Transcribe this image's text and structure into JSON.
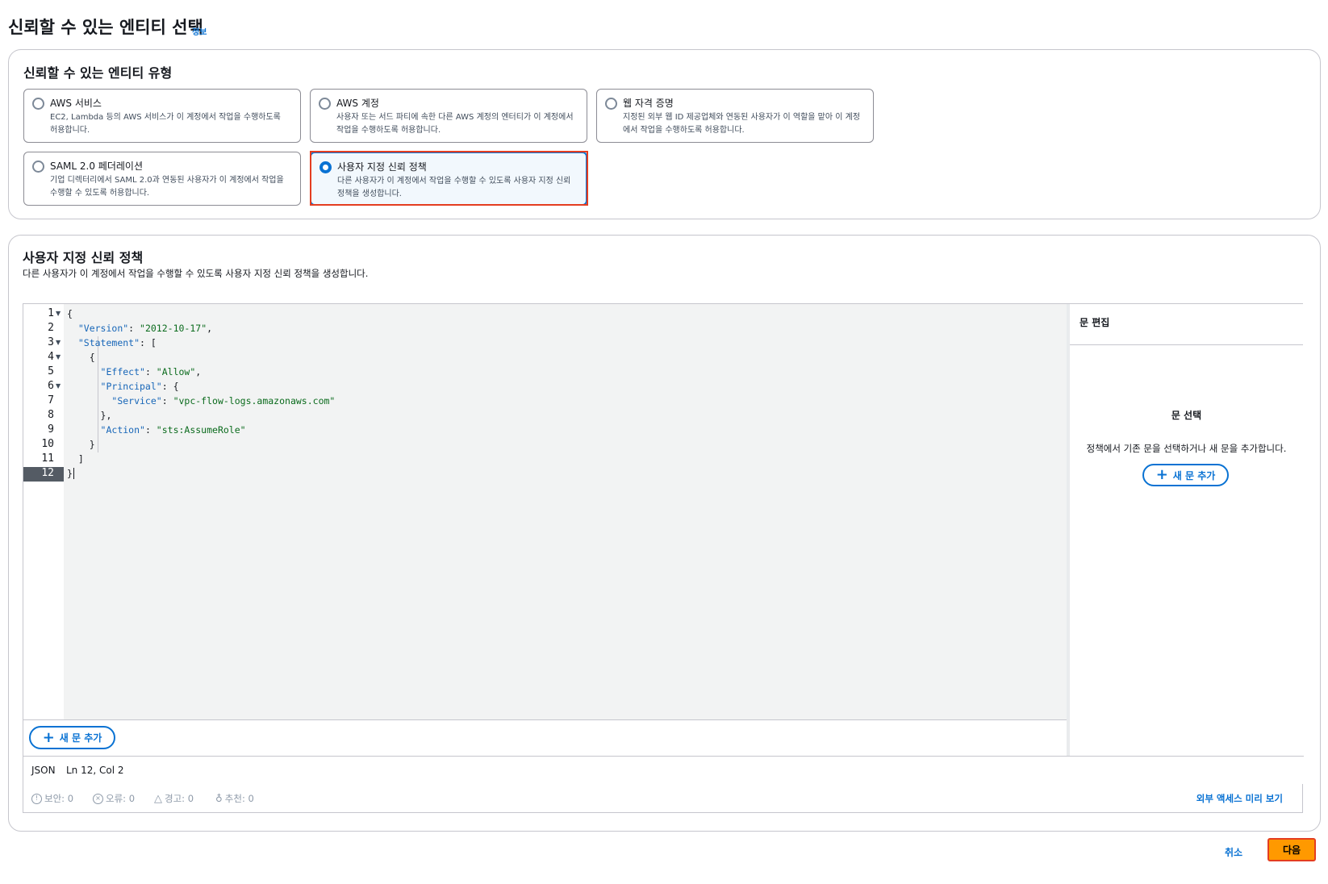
{
  "header": {
    "title": "신뢰할 수 있는 엔티티 선택",
    "info_link": "정보"
  },
  "entity_type_panel": {
    "title": "신뢰할 수 있는 엔티티 유형",
    "options": [
      {
        "label": "AWS 서비스",
        "description": "EC2, Lambda 등의 AWS 서비스가 이 계정에서 작업을 수행하도록 허용합니다.",
        "selected": false
      },
      {
        "label": "AWS 계정",
        "description": "사용자 또는 서드 파티에 속한 다른 AWS 계정의 엔터티가 이 계정에서 작업을 수행하도록 허용합니다.",
        "selected": false
      },
      {
        "label": "웹 자격 증명",
        "description": "지정된 외부 웹 ID 제공업체와 연동된 사용자가 이 역할을 맡아 이 계정에서 작업을 수행하도록 허용합니다.",
        "selected": false
      },
      {
        "label": "SAML 2.0 페더레이션",
        "description": "기업 디렉터리에서 SAML 2.0과 연동된 사용자가 이 계정에서 작업을 수행할 수 있도록 허용합니다.",
        "selected": false
      },
      {
        "label": "사용자 지정 신뢰 정책",
        "description": "다른 사용자가 이 계정에서 작업을 수행할 수 있도록 사용자 지정 신뢰 정책을 생성합니다.",
        "selected": true
      }
    ]
  },
  "custom_policy_panel": {
    "title": "사용자 지정 신뢰 정책",
    "description": "다른 사용자가 이 계정에서 작업을 수행할 수 있도록 사용자 지정 신뢰 정책을 생성합니다."
  },
  "editor": {
    "line_numbers": [
      "1",
      "2",
      "3",
      "4",
      "5",
      "6",
      "7",
      "8",
      "9",
      "10",
      "11",
      "12"
    ],
    "code": {
      "l1": "{",
      "l2_key": "\"Version\"",
      "l2_val": "\"2012-10-17\"",
      "l3_key": "\"Statement\"",
      "l3_rest": ": [",
      "l4": "{",
      "l5_key": "\"Effect\"",
      "l5_val": "\"Allow\"",
      "l6_key": "\"Principal\"",
      "l6_rest": ": {",
      "l7_key": "\"Service\"",
      "l7_val": "\"vpc-flow-logs.amazonaws.com\"",
      "l8": "},",
      "l9_key": "\"Action\"",
      "l9_val": "\"sts:AssumeRole\"",
      "l10": "}",
      "l11": "]",
      "l12": "}"
    },
    "add_statement_label": "새 문 추가",
    "status_mode": "JSON",
    "status_position": "Ln 12, Col 2"
  },
  "side_panel": {
    "title": "문 편집",
    "empty_title": "문 선택",
    "empty_description": "정책에서 기존 문을 선택하거나 새 문을 추가합니다.",
    "add_statement_label": "새 문 추가"
  },
  "validation": {
    "security": "보안: 0",
    "errors": "오류: 0",
    "warnings": "경고: 0",
    "suggestions": "추천: 0",
    "preview_link": "외부 액세스 미리 보기"
  },
  "footer": {
    "cancel_label": "취소",
    "next_label": "다음"
  },
  "colors": {
    "accent": "#0972d3",
    "primary_button": "#ff9900",
    "highlight_box": "#e43d20"
  }
}
